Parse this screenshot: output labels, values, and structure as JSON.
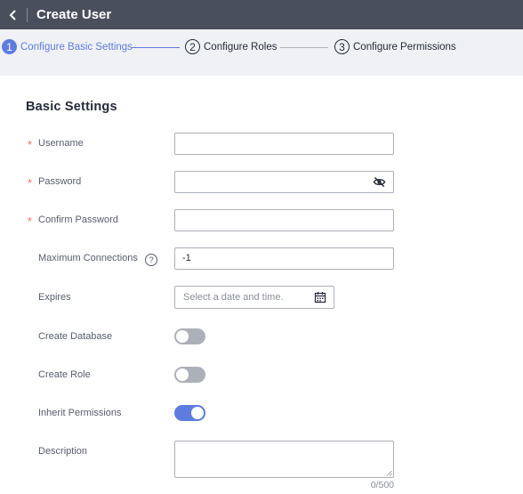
{
  "header": {
    "title": "Create User",
    "back_icon": "chevron-left-icon"
  },
  "steps": [
    {
      "number": "1",
      "label": "Configure Basic Settings",
      "state": "active"
    },
    {
      "number": "2",
      "label": "Configure Roles",
      "state": "todo"
    },
    {
      "number": "3",
      "label": "Configure Permissions",
      "state": "todo"
    }
  ],
  "section": {
    "title": "Basic Settings"
  },
  "form": {
    "required_mark": "*",
    "username": {
      "label": "Username",
      "value": ""
    },
    "password": {
      "label": "Password",
      "value": "",
      "toggle_icon": "eye-hidden-icon"
    },
    "confirm_password": {
      "label": "Confirm Password",
      "value": ""
    },
    "max_connections": {
      "label": "Maximum Connections",
      "value": "-1",
      "help_icon": "question-icon",
      "help_glyph": "?"
    },
    "expires": {
      "label": "Expires",
      "placeholder": "Select a date and time.",
      "icon": "calendar-icon"
    },
    "create_database": {
      "label": "Create Database",
      "enabled": false
    },
    "create_role": {
      "label": "Create Role",
      "enabled": false
    },
    "inherit_permissions": {
      "label": "Inherit Permissions",
      "enabled": true
    },
    "description": {
      "label": "Description",
      "value": "",
      "counter": "0/500"
    }
  },
  "colors": {
    "topbar": "#4a4f5c",
    "accent": "#5e7ce0",
    "required": "#f66f6a",
    "steps_background": "#eff1f4"
  }
}
